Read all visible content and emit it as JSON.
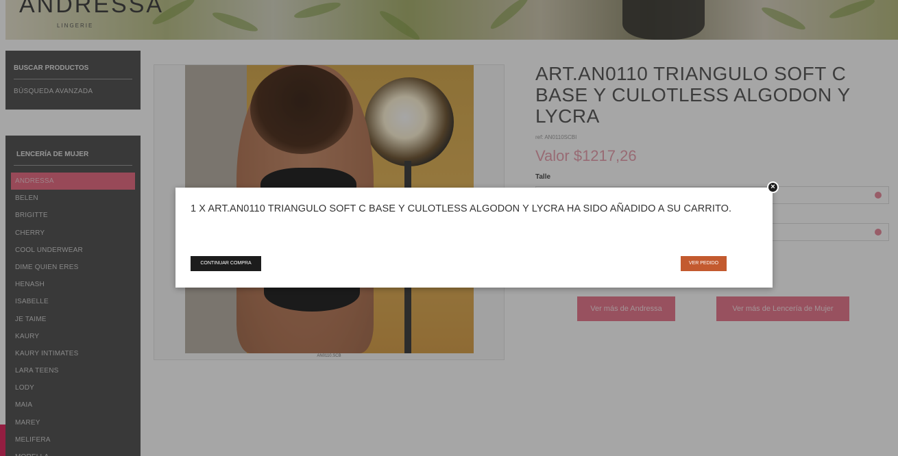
{
  "header": {
    "brand": "ANDRESSA",
    "brand_sub": "LINGERIE"
  },
  "sidebar": {
    "search_title": "BUSCAR PRODUCTOS",
    "advanced_search": "BÚSQUEDA AVANZADA",
    "category_title": "LENCERÍA DE MUJER",
    "items": [
      "ANDRESSA",
      "BELEN",
      "BRIGITTE",
      "CHERRY",
      "COOL UNDERWEAR",
      "DIME QUIEN ERES",
      "HENASH",
      "ISABELLE",
      "JE TAIME",
      "KAURY",
      "KAURY INTIMATES",
      "LARA TEENS",
      "LODY",
      "MAIA",
      "MAREY",
      "MELIFERA",
      "MORELLA"
    ],
    "active_item": "ANDRESSA"
  },
  "product": {
    "title": "ART.AN0110 TRIANGULO SOFT C BASE Y CULOTLESS ALGODON Y LYCRA",
    "code": "ref: AN0110SCBI",
    "price": "Valor $1217,26",
    "size_label": "Talle",
    "image_caption": "AN0110.SCB",
    "more_brand_button": "Ver más de Andressa",
    "more_category_button": "Ver más de Lencería de Mujer"
  },
  "modal": {
    "message": "1 X ART.AN0110 TRIANGULO SOFT C BASE Y CULOTLESS ALGODON Y LYCRA HA SIDO AÑADIDO A SU CARRITO.",
    "continue_button": "CONTINUAR COMPRA",
    "order_button": "VER PEDIDO",
    "close_symbol": "×"
  },
  "colors": {
    "accent_pink": "#e9778d",
    "order_button": "#c35a2f",
    "sidebar_bg": "#505050"
  }
}
